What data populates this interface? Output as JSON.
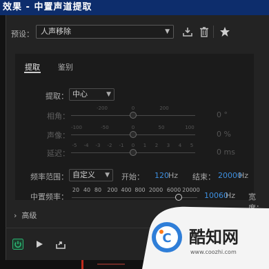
{
  "window": {
    "title": "效果 - 中置声道提取"
  },
  "preset": {
    "label": "预设：",
    "value": "人声移除"
  },
  "toolbar_icons": [
    "download-icon",
    "trash-icon",
    "star-icon"
  ],
  "tabs": [
    {
      "label": "提取",
      "active": true
    },
    {
      "label": "鉴别",
      "active": false
    }
  ],
  "extract": {
    "label": "提取：",
    "value": "中心"
  },
  "sliders": [
    {
      "label": "相角：",
      "scale": [
        "-200",
        "0",
        "200"
      ],
      "value": "0",
      "unit": "°"
    },
    {
      "label": "声像：",
      "scale": [
        "-100",
        "-50",
        "0",
        "50",
        "100"
      ],
      "value": "0",
      "unit": "%"
    },
    {
      "label": "延迟：",
      "scale": [
        "-5",
        "-4",
        "-3",
        "-2",
        "-1",
        "0",
        "1",
        "2",
        "3",
        "4",
        "5"
      ],
      "value": "0",
      "unit": "ms"
    }
  ],
  "frequency_range": {
    "label": "频率范围：",
    "value": "自定义",
    "start_label": "开始：",
    "start_value": "120",
    "start_unit": "Hz",
    "end_label": "结束：",
    "end_value": "20000",
    "end_unit": "Hz"
  },
  "center_freq": {
    "label": "中置频率：",
    "scale": [
      "20",
      "40",
      "80",
      "200",
      "400",
      "800",
      "2000",
      "6000",
      "20000"
    ],
    "value": "10060",
    "unit": "Hz",
    "width_label": "宽度："
  },
  "advanced": {
    "label": "高级"
  },
  "bottom_icons": [
    "power-icon",
    "play-icon",
    "export-icon"
  ],
  "watermark": {
    "name": "酷知网",
    "url": "www.coozhi.com"
  },
  "colors": {
    "title_bar": "#0d2d6c",
    "accent": "#3d8fe0",
    "power": "#2bb673"
  }
}
